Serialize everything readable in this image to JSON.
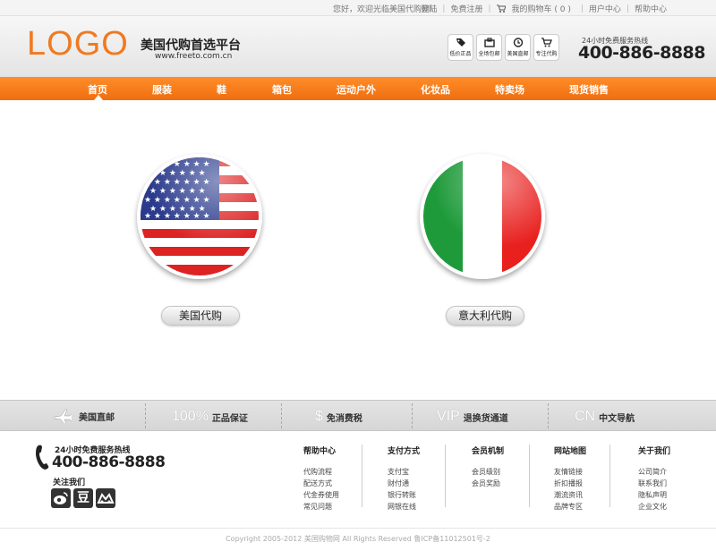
{
  "topbar": {
    "greeting": "您好，欢迎光临美国代购网!",
    "login": "登陆",
    "register": "免费注册",
    "cart": "我的购物车 ( 0 )",
    "user_center": "用户中心",
    "help_center": "帮助中心"
  },
  "header": {
    "logo": "LOGO",
    "site_name": "美国代购首选平台",
    "site_url": "www.freeto.com.cn",
    "badges": [
      "低价正品",
      "全场包邮",
      "美国直邮",
      "专注代购"
    ],
    "hotline_label": "24小时免费服务热线",
    "hotline": "400-886-8888"
  },
  "nav": {
    "items": [
      "首页",
      "服装",
      "鞋",
      "箱包",
      "运动户外",
      "化妆品",
      "特卖场",
      "现货销售"
    ],
    "active": "首页"
  },
  "main": {
    "usa_button": "美国代购",
    "italy_button": "意大利代购"
  },
  "features": [
    {
      "big": "",
      "label": "美国直邮",
      "icon": "plane-icon"
    },
    {
      "big": "100%",
      "label": "正品保证",
      "icon": ""
    },
    {
      "big": "$",
      "label": "免消费税",
      "icon": ""
    },
    {
      "big": "VIP",
      "label": "退换货通道",
      "icon": ""
    },
    {
      "big": "CN",
      "label": "中文导航",
      "icon": ""
    }
  ],
  "footer": {
    "hotline_label": "24小时免费服务热线",
    "hotline": "400-886-8888",
    "follow": "关注我们",
    "social": [
      "weibo-icon",
      "douban-icon",
      "kaixin-icon"
    ],
    "columns": [
      {
        "title": "帮助中心",
        "links": [
          "代购流程",
          "配送方式",
          "代金券使用",
          "常见问题"
        ]
      },
      {
        "title": "支付方式",
        "links": [
          "支付宝",
          "财付通",
          "银行转账",
          "网银在线"
        ]
      },
      {
        "title": "会员机制",
        "links": [
          "会员级别",
          "会员奖励"
        ]
      },
      {
        "title": "网站地图",
        "links": [
          "友情链接",
          "折扣播报",
          "潮流资讯",
          "品牌专区"
        ]
      },
      {
        "title": "关于我们",
        "links": [
          "公司简介",
          "联系我们",
          "隐私声明",
          "企业文化"
        ]
      }
    ],
    "copyright": "Copyright  2005-2012  美国购物网  All Rights Reserved  鲁ICP备11012501号-2"
  },
  "colors": {
    "accent": "#f07a20",
    "nav": "#f47618"
  }
}
